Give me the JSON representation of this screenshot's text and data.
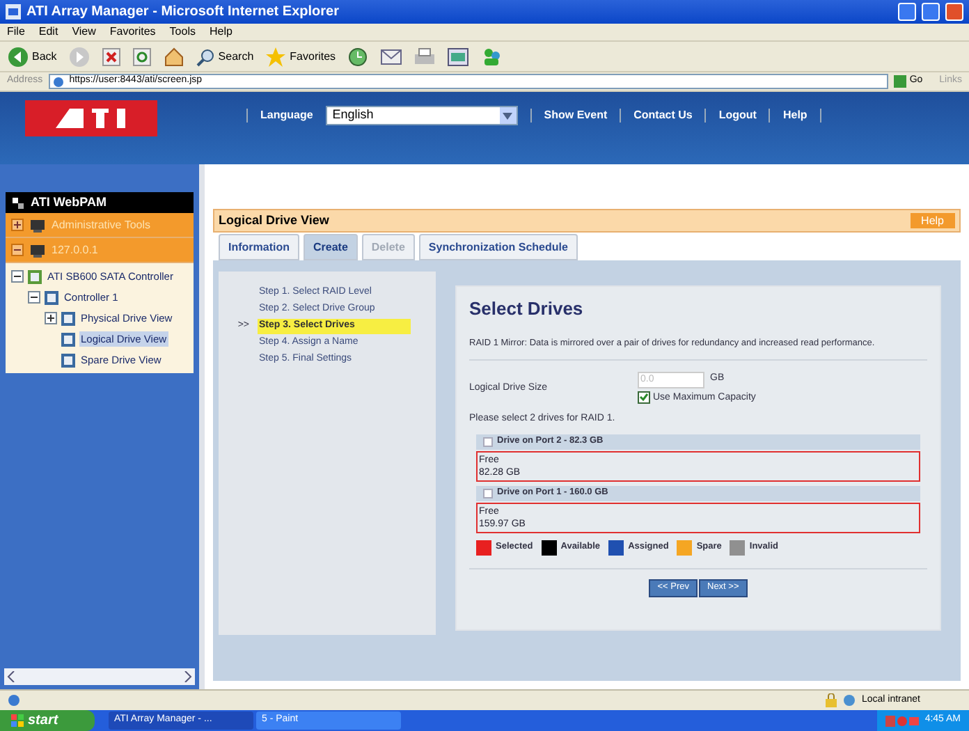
{
  "window": {
    "title": "ATI Array Manager - Microsoft Internet Explorer"
  },
  "menu": [
    "File",
    "Edit",
    "View",
    "Favorites",
    "Tools",
    "Help"
  ],
  "toolbar": [
    {
      "kind": "back",
      "label": "Back"
    },
    {
      "kind": "forward"
    },
    {
      "kind": "stop"
    },
    {
      "kind": "refresh"
    },
    {
      "kind": "home"
    },
    {
      "kind": "search",
      "label": "Search"
    },
    {
      "kind": "favorites",
      "label": "Favorites"
    },
    {
      "kind": "history"
    },
    {
      "kind": "mail"
    },
    {
      "kind": "print"
    },
    {
      "kind": "edit"
    },
    {
      "kind": "messenger"
    }
  ],
  "address": {
    "label": "Address",
    "value": "https://user:8443/ati/screen.jsp",
    "go": "Go",
    "links": "Links"
  },
  "header": {
    "language_label": "Language",
    "language": "English",
    "links": [
      "Show Event",
      "Contact Us",
      "Logout",
      "Help"
    ]
  },
  "tree": [
    {
      "label": "ATI WebPAM",
      "kind": "root"
    },
    {
      "label": "Administrative Tools",
      "kind": "group",
      "expanded": false
    },
    {
      "label": "127.0.0.1",
      "kind": "group",
      "expanded": true,
      "children": [
        {
          "label": "ATI SB600 SATA Controller",
          "expanded": true,
          "selected": false,
          "children": [
            {
              "label": "Controller 1",
              "expanded": true,
              "selected": false,
              "children": [
                {
                  "label": "Physical Drive View",
                  "expanded": false,
                  "selected": false
                },
                {
                  "label": "Logical Drive View",
                  "selected": true
                },
                {
                  "label": "Spare Drive View",
                  "selected": false
                }
              ]
            }
          ]
        }
      ]
    }
  ],
  "panel": {
    "title": "Logical Drive View",
    "help": "Help"
  },
  "tabs": [
    {
      "label": "Information",
      "selected": false,
      "disabled": false
    },
    {
      "label": "Create",
      "selected": true,
      "disabled": false
    },
    {
      "label": "Delete",
      "selected": false,
      "disabled": true
    },
    {
      "label": "Synchronization Schedule",
      "selected": false,
      "disabled": false
    }
  ],
  "steps": [
    {
      "label": "Step 1. Select RAID Level",
      "selected": false
    },
    {
      "label": "Step 2. Select Drive Group",
      "selected": false
    },
    {
      "label": "Step 3. Select Drives",
      "selected": true,
      "marker": ">>"
    },
    {
      "label": "Step 4. Assign a Name",
      "selected": false
    },
    {
      "label": "Step 5. Final Settings",
      "selected": false
    }
  ],
  "card": {
    "title": "Select Drives",
    "description": "RAID 1 Mirror: Data is mirrored over a pair of drives for redundancy and increased read performance.",
    "size_label": "Logical Drive Size",
    "size_value": "0.0",
    "size_unit": "GB",
    "max_capacity": {
      "label": "Use Maximum Capacity",
      "checked": true
    },
    "prompt": "Please select 2 drives for RAID 1.",
    "drives": [
      {
        "label": "Drive on Port 2 - 82.3 GB",
        "checked": false,
        "status": "Free",
        "size": "82.28 GB",
        "color": "#e03030"
      },
      {
        "label": "Drive on Port 1 - 160.0 GB",
        "checked": false,
        "status": "Free",
        "size": "159.97 GB",
        "color": "#e03030"
      }
    ],
    "legend": [
      {
        "label": "Selected",
        "color": "#e82020"
      },
      {
        "label": "Available",
        "color": "#000000"
      },
      {
        "label": "Assigned",
        "color": "#2050b0"
      },
      {
        "label": "Spare",
        "color": "#f5a623"
      },
      {
        "label": "Invalid",
        "color": "#909090"
      }
    ],
    "buttons": [
      "<< Prev",
      "Next >>"
    ]
  },
  "status_bar": {
    "zone": "Local intranet"
  },
  "taskbar": {
    "start": "start",
    "items": [
      {
        "label": "ATI Array Manager - ...",
        "selected": true
      },
      {
        "label": "5 - Paint",
        "selected": false
      }
    ],
    "clock": "4:45 AM"
  }
}
